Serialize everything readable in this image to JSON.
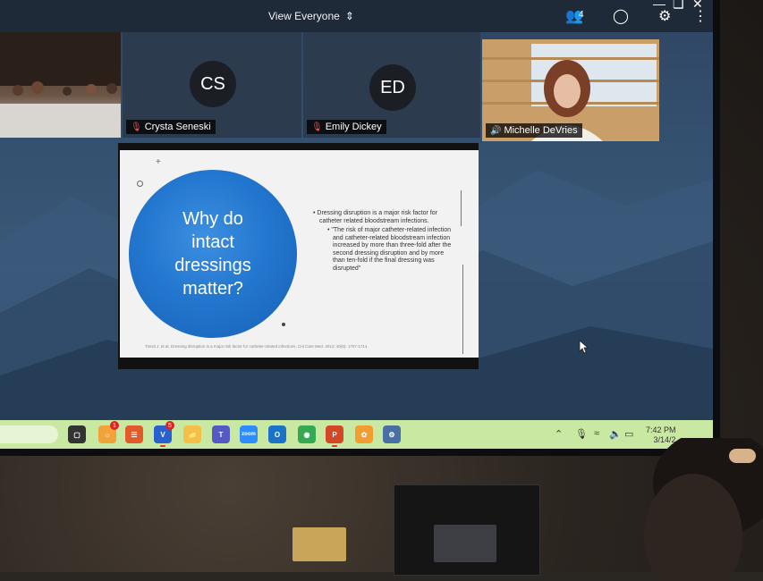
{
  "topbar": {
    "view_label": "View Everyone",
    "participant_count": "4"
  },
  "participants": [
    {
      "name": "",
      "initials": "",
      "kind": "room-video",
      "mic": "none"
    },
    {
      "name": "Crysta Seneski",
      "initials": "CS",
      "kind": "avatar",
      "mic": "muted"
    },
    {
      "name": "Emily Dickey",
      "initials": "ED",
      "kind": "avatar",
      "mic": "muted"
    },
    {
      "name": "Michelle DeVries",
      "initials": "",
      "kind": "video",
      "mic": "active"
    }
  ],
  "slide": {
    "title": "Why do intact dressings matter?",
    "bullet_main": "Dressing disruption is a major risk factor for catheter related bloodstream infections.",
    "bullet_sub": "\"The risk of major catheter-related infection and catheter-related bloodstream infection increased by more than three-fold after the second dressing disruption and by more than ten-fold if the final dressing was disrupted\"",
    "citation": "Timsit J, et al. Dressing disruption is a major risk factor for catheter-related infections.  Crit Care Med. 2012; 40(6): 1707-1714."
  },
  "taskbar": {
    "apps": [
      {
        "icon": "task-view-icon",
        "color": "#333333"
      },
      {
        "icon": "widgets-icon",
        "color": "#f2a23a",
        "badge": "1"
      },
      {
        "icon": "chat-icon",
        "color": "#e35a2a"
      },
      {
        "icon": "video-conference-icon",
        "color": "#2a5fd0",
        "badge": "5"
      },
      {
        "icon": "folder-icon",
        "color": "#f5c04a"
      },
      {
        "icon": "teams-icon",
        "color": "#5559c4"
      },
      {
        "icon": "zoom-icon",
        "color": "#2d8cff"
      },
      {
        "icon": "outlook-icon",
        "color": "#1a73c8"
      },
      {
        "icon": "chrome-icon",
        "color": "#34a853"
      },
      {
        "icon": "powerpoint-icon",
        "color": "#d24726"
      },
      {
        "icon": "pinwheel-icon",
        "color": "#f39c32"
      },
      {
        "icon": "settings-icon",
        "color": "#4a6fa5"
      }
    ],
    "time": "7:42 PM",
    "date": "3/14/2"
  },
  "colors": {
    "taskbar": "#c9e8a2",
    "slide_circle": "#2377cf",
    "topbar": "#1f2a38"
  }
}
